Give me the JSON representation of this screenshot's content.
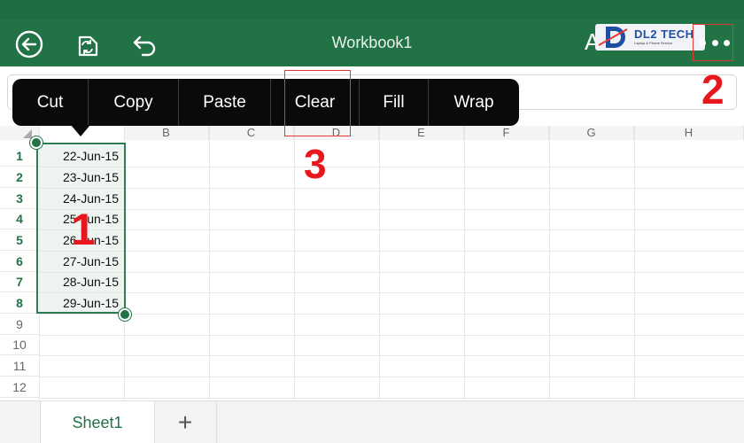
{
  "toolbar": {
    "title": "Workbook1",
    "back_icon": "circle-back-arrow-icon",
    "sync_icon": "document-sync-icon",
    "undo_icon": "undo-icon",
    "font_icon_label": "A",
    "more_icon": "more-ellipsis-icon"
  },
  "logo": {
    "text": "DL2 TECH",
    "tagline": "Laptop & Phone Service"
  },
  "context_menu": {
    "items": [
      {
        "label": "Cut"
      },
      {
        "label": "Copy"
      },
      {
        "label": "Paste"
      },
      {
        "label": "Clear"
      },
      {
        "label": "Fill"
      },
      {
        "label": "Wrap"
      }
    ]
  },
  "callouts": {
    "one": "1",
    "two": "2",
    "three": "3"
  },
  "sheet": {
    "columns": [
      "B",
      "C",
      "D",
      "E",
      "F",
      "G",
      "H"
    ],
    "rows": [
      "1",
      "2",
      "3",
      "4",
      "5",
      "6",
      "7",
      "8",
      "9",
      "10",
      "11",
      "12"
    ],
    "selected_rows": 8,
    "column_a_values": [
      "22-Jun-15",
      "23-Jun-15",
      "24-Jun-15",
      "25-Jun-15",
      "26-Jun-15",
      "27-Jun-15",
      "28-Jun-15",
      "29-Jun-15"
    ]
  },
  "tabs": {
    "sheet1": "Sheet1",
    "add_label": "+"
  },
  "colors": {
    "accent": "#217346",
    "callout_red": "#e8161d",
    "menu_bg": "#0a0a0a"
  }
}
